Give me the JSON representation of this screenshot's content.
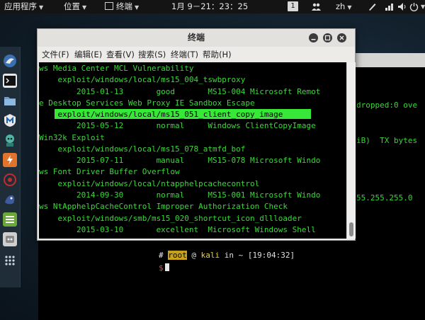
{
  "top_panel": {
    "apps_menu": "应用程序",
    "places_menu": "位置",
    "active_app": "终端",
    "clock": "1月 9－21：23：25",
    "workspace": "1",
    "user_icon": "people-icon",
    "input_method": "zh",
    "icons": [
      "pen-icon",
      "network-icon",
      "volume-icon",
      "power-icon"
    ]
  },
  "dock": {
    "items": [
      "browser-icon",
      "terminal-icon",
      "files-icon",
      "metasploit-icon",
      "armitage-icon",
      "burpsuite-icon",
      "maltego-icon",
      "beef-icon",
      "notes-icon",
      "settings-icon",
      "apps-grid-icon"
    ]
  },
  "bg_terminal": {
    "lines": [
      "dropped:0 ove",
      "iB)  TX bytes",
      "55.255.255.0"
    ],
    "prompt": {
      "hash": "#",
      "user": "root",
      "at": "@",
      "host": "kali",
      "in": "in",
      "tilde": "~",
      "time": "[19:04:32]",
      "dollar": "$"
    }
  },
  "window": {
    "title": "终端",
    "menu": [
      "文件(F)",
      "编辑(E)",
      "查看(V)",
      "搜索(S)",
      "终端(T)",
      "帮助(H)"
    ],
    "lines": [
      "ws Media Center MCL Vulnerability",
      "    exploit/windows/local/ms15_004_tswbproxy",
      "        2015-01-13       good       MS15-004 Microsoft Remot",
      "e Desktop Services Web Proxy IE Sandbox Escape",
      "    exploit/windows/local/ms15_051_client_copy_image",
      "        2015-05-12       normal     Windows ClientCopyImage",
      "Win32k Exploit",
      "    exploit/windows/local/ms15_078_atmfd_bof",
      "        2015-07-11       manual     MS15-078 Microsoft Windo",
      "ws Font Driver Buffer Overflow",
      "    exploit/windows/local/ntapphelpcachecontrol",
      "        2014-09-30       normal     MS15-001 Microsoft Windo",
      "ws NtApphelpCacheControl Improper Authorization Check",
      "    exploit/windows/smb/ms15_020_shortcut_icon_dllloader",
      "        2015-03-10       excellent  Microsoft Windows Shell",
      "    ",
      "    ",
      "    "
    ],
    "highlighted_line": 4,
    "colors": {
      "text": "#3cd63c",
      "highlight": "#38e838"
    }
  }
}
